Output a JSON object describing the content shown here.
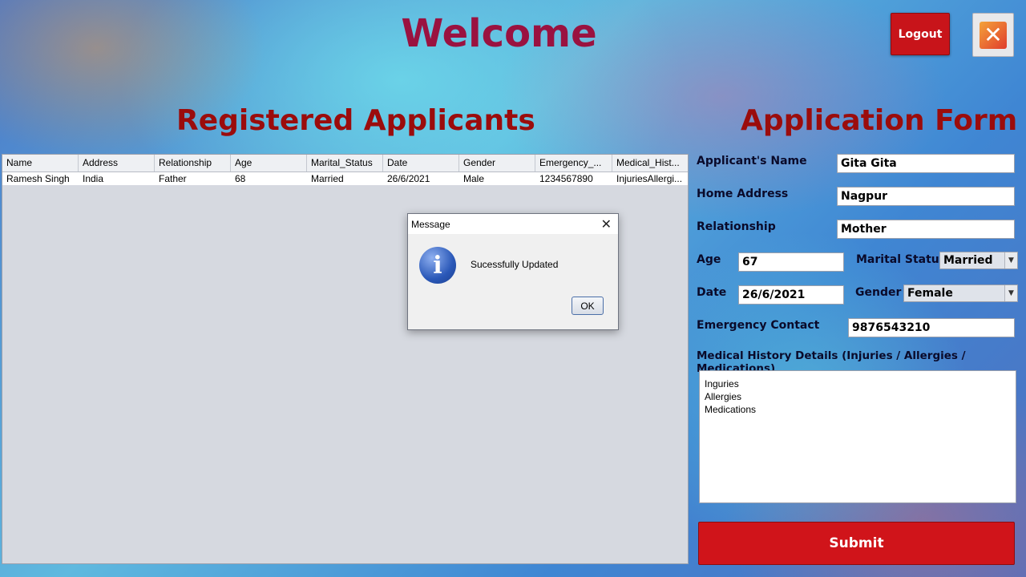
{
  "header": {
    "welcome": "Welcome",
    "logout_label": "Logout",
    "close_icon": "close-icon"
  },
  "registered": {
    "title": "Registered Applicants",
    "columns": [
      "Name",
      "Address",
      "Relationship",
      "Age",
      "Marital_Status",
      "Date",
      "Gender",
      "Emergency_...",
      "Medical_Hist..."
    ],
    "rows": [
      [
        "Ramesh Singh",
        "India",
        "Father",
        "68",
        "Married",
        "26/6/2021",
        "Male",
        "1234567890",
        "InjuriesAllergi..."
      ]
    ]
  },
  "form": {
    "title": "Application Form",
    "name_label": "Applicant's Name",
    "name_value": "Gita Gita",
    "address_label": "Home Address",
    "address_value": "Nagpur",
    "relationship_label": "Relationship",
    "relationship_value": "Mother",
    "age_label": "Age",
    "age_value": "67",
    "marital_label": "Marital Status",
    "marital_value": "Married",
    "date_label": "Date",
    "date_value": "26/6/2021",
    "gender_label": "Gender",
    "gender_value": "Female",
    "emergency_label": "Emergency Contact",
    "emergency_value": "9876543210",
    "medical_label": "Medical History Details (Injuries / Allergies / Medications)",
    "medical_lines": [
      "Inguries",
      "Allergies",
      "Medications"
    ],
    "submit_label": "Submit"
  },
  "dialog": {
    "title": "Message",
    "message": "Sucessfully Updated",
    "ok_label": "OK",
    "icon": "info-icon",
    "close_glyph": "✕"
  },
  "colors": {
    "title": "#9a1240",
    "section_heading": "#9b0c0c",
    "button_red": "#d0141a"
  }
}
